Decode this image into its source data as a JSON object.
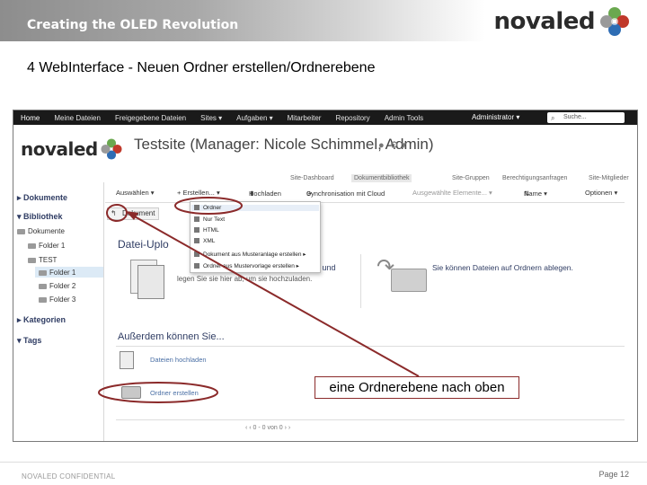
{
  "banner": {
    "title": "Creating the OLED Revolution",
    "brand": "novaled"
  },
  "slide": {
    "title": "4 WebInterface - Neuen Ordner erstellen/Ordnerebene"
  },
  "topnav": {
    "items": [
      "Home",
      "Meine Dateien",
      "Freigegebene Dateien",
      "Sites ▾",
      "Aufgaben ▾",
      "Mitarbeiter",
      "Repository",
      "Admin Tools"
    ],
    "admin": "Administrator ▾",
    "search_placeholder": "Suche..."
  },
  "site": {
    "logo": "novaled",
    "title": "Testsite (Manager: Nicole Schimmel, Admin)"
  },
  "sitenav": [
    "Site-Dashboard",
    "Dokumentbibliothek",
    "Site-Gruppen",
    "Berechtigungsanfragen",
    "Site-Mitglieder"
  ],
  "left": {
    "dokumente": "▸ Dokumente",
    "bibliothek": "▾ Bibliothek",
    "tree": [
      "Dokumente",
      "Folder 1",
      "TEST",
      "Folder 1",
      "Folder 2",
      "Folder 3"
    ],
    "kategorien": "▸ Kategorien",
    "tags": "▾ Tags"
  },
  "toolbar": {
    "select": "Auswählen ▾",
    "create": "+ Erstellen... ▾",
    "upload": "Hochladen",
    "sync": "Synchronisation mit Cloud",
    "selected": "Ausgewählte Elemente... ▾",
    "sort": "Name ▾",
    "options": "Optionen ▾"
  },
  "breadcrumb": "Dokument",
  "dropdown": [
    "Ordner",
    "Nur Text",
    "HTML",
    "XML",
    "Dokument aus Musteranlage erstellen ▸",
    "Ordner aus Mustervorlage erstellen ▸"
  ],
  "content": {
    "title": "Datei-Uplo",
    "upload_line1": "p und",
    "upload_line2": "legen Sie sie hier ab, um sie hochzuladen.",
    "drop_text": "Sie können Dateien auf Ordnern ablegen.",
    "also_title": "Außerdem können Sie...",
    "action_upload": "Dateien hochladen",
    "action_folder": "Ordner erstellen",
    "pager": "‹ ‹   0 - 0 von 0   › ›"
  },
  "callout": "eine Ordnerebene nach oben",
  "footer": {
    "left": "NOVALED CONFIDENTIAL",
    "right": "Page 12"
  },
  "colors": {
    "annotation": "#8b2a2a",
    "link": "#4a6fa5",
    "heading": "#2f3c63"
  }
}
